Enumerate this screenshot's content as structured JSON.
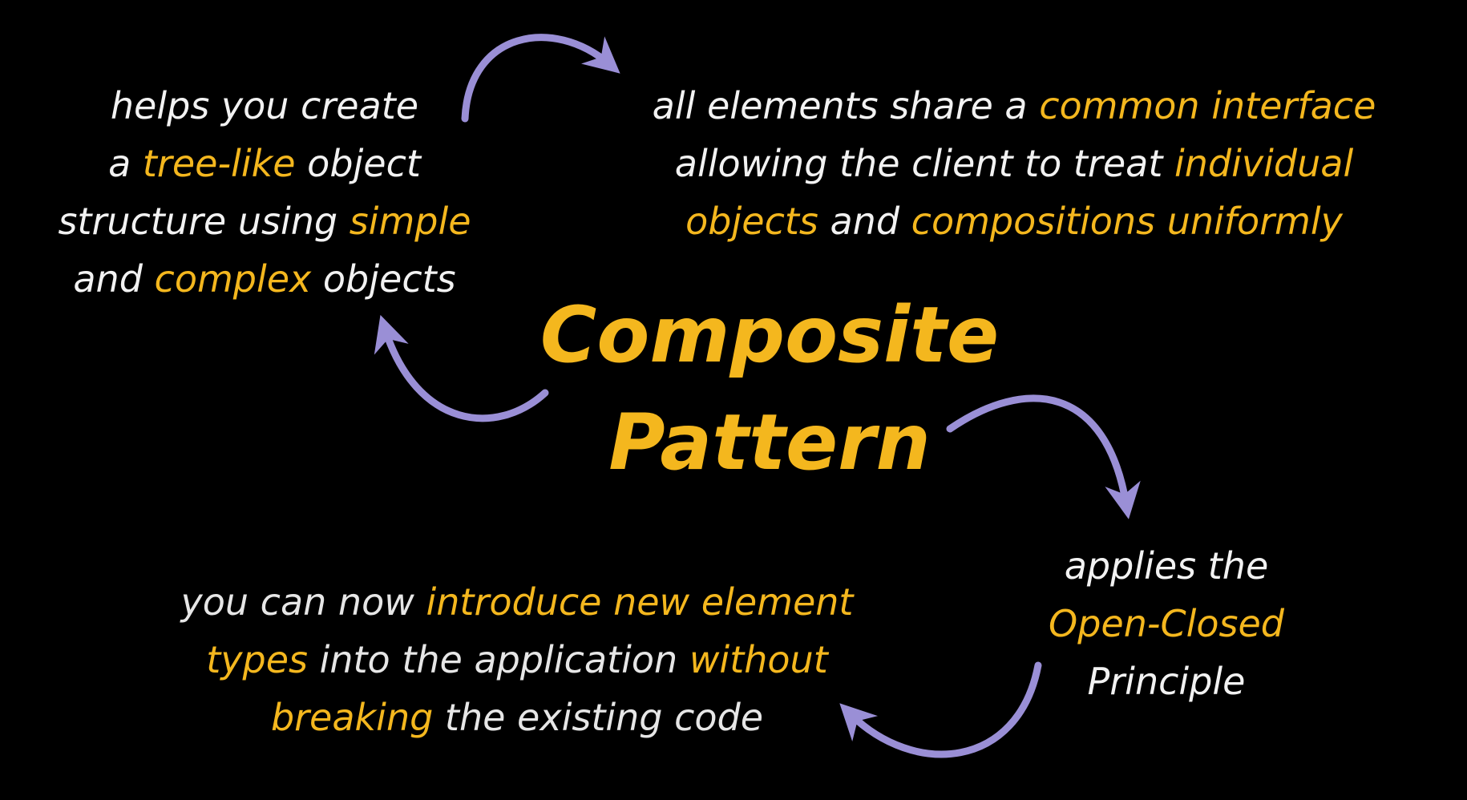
{
  "title": {
    "line1": "Composite",
    "line2": "Pattern"
  },
  "top_left": {
    "l1": "helps you create",
    "l2a": "a ",
    "l2b": "tree-like",
    "l2c": " object",
    "l3a": "structure using ",
    "l3b": "simple",
    "l4a": "and ",
    "l4b": "complex",
    "l4c": " objects"
  },
  "top_right": {
    "l1a": "all elements share a ",
    "l1b": "common interface",
    "l2a": "allowing the client to treat ",
    "l2b": "individual",
    "l3a": "objects",
    "l3b": " and ",
    "l3c": "compositions uniformly"
  },
  "bottom_right": {
    "l1": "applies the",
    "l2": "Open-Closed",
    "l3": "Principle"
  },
  "bottom_left": {
    "l1a": "you can now ",
    "l1b": "introduce new element",
    "l2a": "types",
    "l2b": " into the application ",
    "l2c": "without",
    "l3a": "breaking",
    "l3b": " the existing code"
  },
  "colors": {
    "background": "#000000",
    "text": "#f2f2f2",
    "highlight": "#f4b71e",
    "arrow": "#9a8fd6"
  },
  "icons": [
    "curved-arrow-icon"
  ]
}
